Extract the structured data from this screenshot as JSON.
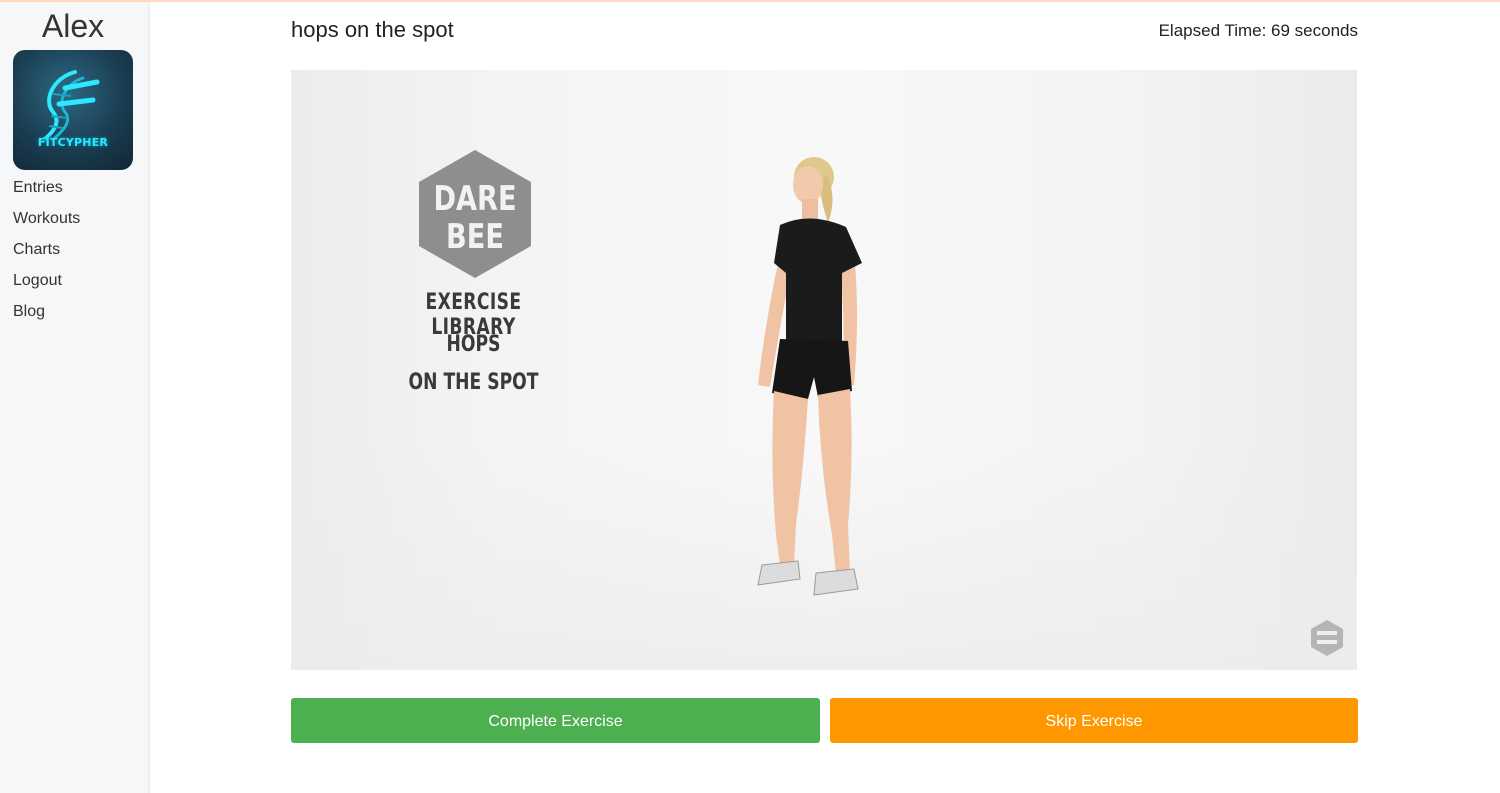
{
  "sidebar": {
    "user_name": "Alex",
    "logo_text": "FITCYPHER",
    "nav_items": [
      {
        "label": "Entries"
      },
      {
        "label": "Workouts"
      },
      {
        "label": "Charts"
      },
      {
        "label": "Logout"
      },
      {
        "label": "Blog"
      }
    ]
  },
  "main": {
    "exercise_title": "hops on the spot",
    "elapsed_time": "Elapsed Time: 69 seconds",
    "video": {
      "brand_top": "DARE",
      "brand_bottom": "BEE",
      "library_label": "EXERCISE LIBRARY",
      "exercise_line1": "HOPS",
      "exercise_line2": "ON THE SPOT"
    },
    "buttons": {
      "complete_label": "Complete Exercise",
      "skip_label": "Skip Exercise"
    }
  },
  "colors": {
    "complete": "#4caf50",
    "skip": "#ff9800",
    "sidebar_bg": "#f6f7f9",
    "logo_cyan": "#2ee8ff"
  },
  "icons": {
    "logo": "fitcypher-logo-icon",
    "brand": "darebee-hexagon-icon"
  }
}
